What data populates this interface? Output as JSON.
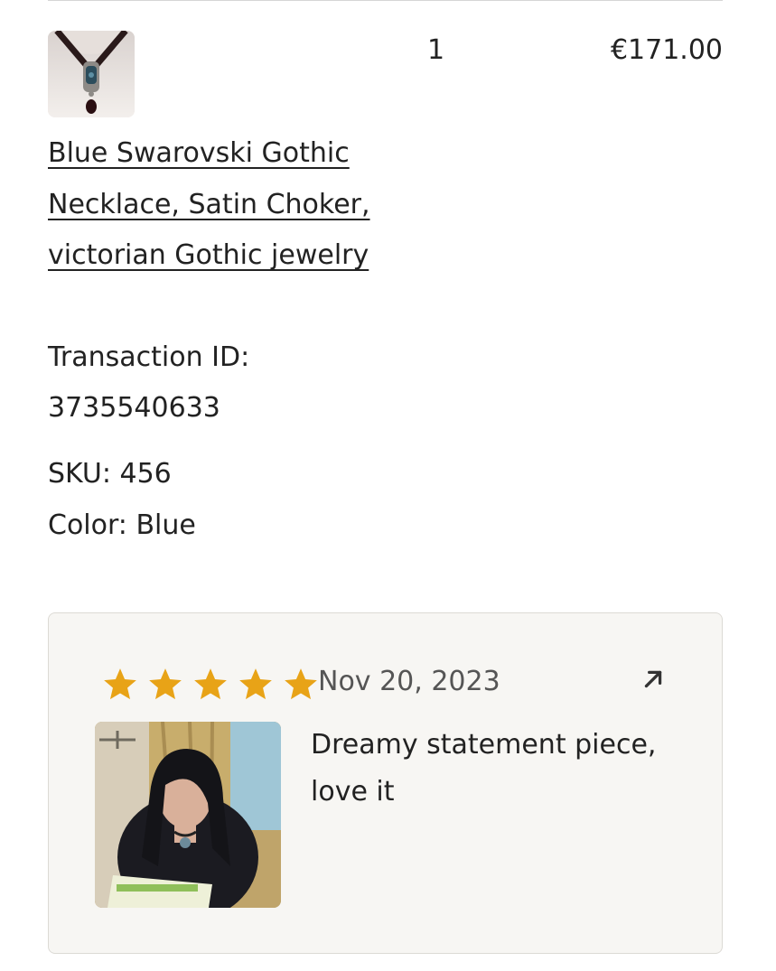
{
  "order_item": {
    "quantity": "1",
    "price": "€171.00",
    "title": "Blue Swarovski Gothic Necklace, Satin Choker, victorian Gothic jewelry",
    "transaction_label": "Transaction ID:",
    "transaction_id": "3735540633",
    "sku": "SKU: 456",
    "color": "Color: Blue",
    "thumbnail_icon": "necklace-product-image"
  },
  "review": {
    "rating": 5,
    "rating_max": 5,
    "date": "Nov 20, 2023",
    "text": "Dreamy statement piece, love it",
    "open_icon": "arrow-up-right-icon",
    "photo_icon": "reviewer-photo"
  },
  "colors": {
    "star": "#e8a317",
    "text": "#222222",
    "muted": "#555555",
    "card_background": "#f7f6f3",
    "card_border": "#dcdad5"
  }
}
